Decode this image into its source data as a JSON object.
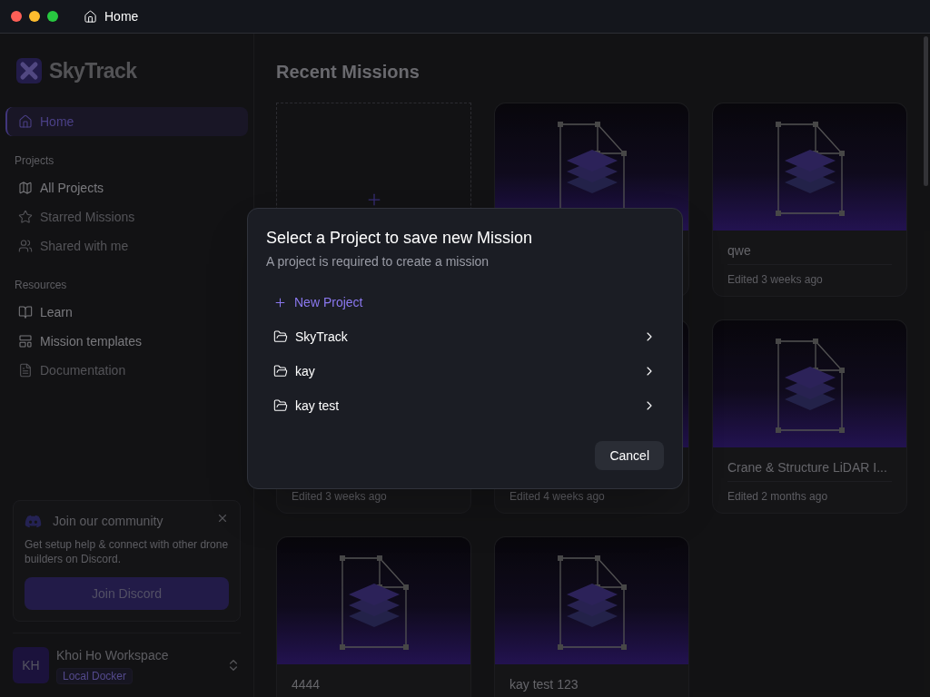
{
  "window": {
    "title": "Home"
  },
  "sidebar": {
    "brand": "SkyTrack",
    "top_items": [
      {
        "label": "Home",
        "selected": true
      }
    ],
    "sections": [
      {
        "heading": "Projects",
        "items": [
          {
            "label": "All Projects",
            "selected": false,
            "disabled": false
          },
          {
            "label": "Starred Missions",
            "selected": false,
            "disabled": true
          },
          {
            "label": "Shared with me",
            "selected": false,
            "disabled": true
          }
        ]
      },
      {
        "heading": "Resources",
        "items": [
          {
            "label": "Learn",
            "selected": false,
            "disabled": false
          },
          {
            "label": "Mission templates",
            "selected": false,
            "disabled": false
          },
          {
            "label": "Documentation",
            "selected": false,
            "disabled": true
          }
        ]
      }
    ],
    "community": {
      "title": "Join our community",
      "text": "Get setup help & connect with other drone builders on Discord.",
      "button": "Join Discord"
    },
    "workspace": {
      "initials": "KH",
      "name": "Khoi Ho Workspace",
      "badge": "Local Docker"
    }
  },
  "main": {
    "heading": "Recent Missions",
    "cards": [
      {
        "kind": "new"
      },
      {
        "kind": "mission"
      },
      {
        "kind": "mission",
        "title": "qwe",
        "edited": "Edited 3 weeks ago"
      },
      {
        "kind": "mission",
        "edited": "Edited 3 weeks ago"
      },
      {
        "kind": "mission",
        "edited": "Edited 4 weeks ago"
      },
      {
        "kind": "mission",
        "title": "Crane & Structure LiDAR I...",
        "edited": "Edited 2 months ago"
      },
      {
        "kind": "mission",
        "title": "4444"
      },
      {
        "kind": "mission",
        "title": "kay test 123"
      }
    ]
  },
  "dialog": {
    "title": "Select a Project to save new Mission",
    "subtitle": "A project is required to create a mission",
    "new_project": "New Project",
    "projects": [
      {
        "name": "SkyTrack"
      },
      {
        "name": "kay"
      },
      {
        "name": "kay test"
      }
    ],
    "cancel": "Cancel"
  }
}
